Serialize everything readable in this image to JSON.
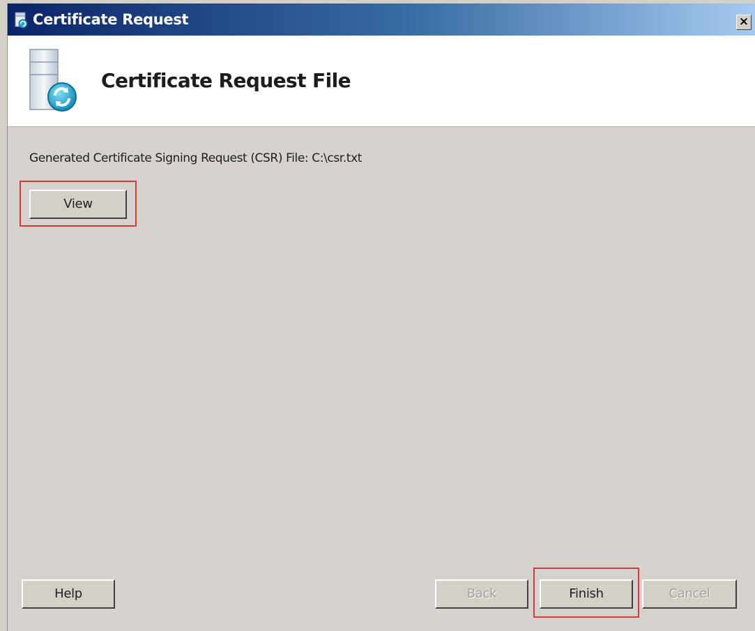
{
  "window": {
    "title": "Certificate Request",
    "close_label": "×"
  },
  "banner": {
    "title": "Certificate Request File"
  },
  "content": {
    "csr_text": "Generated Certificate Signing Request (CSR) File: C:\\csr.txt",
    "view_label": "View"
  },
  "footer": {
    "help_label": "Help",
    "back_label": "Back",
    "finish_label": "Finish",
    "cancel_label": "Cancel"
  },
  "icons": {
    "title_icon": "certificate-request-icon",
    "banner_icon": "server-refresh-icon"
  },
  "colors": {
    "titlebar_start": "#0a246a",
    "titlebar_end": "#a6caf0",
    "dialog_background": "#d6d3ce",
    "highlight": "#e0383a"
  }
}
